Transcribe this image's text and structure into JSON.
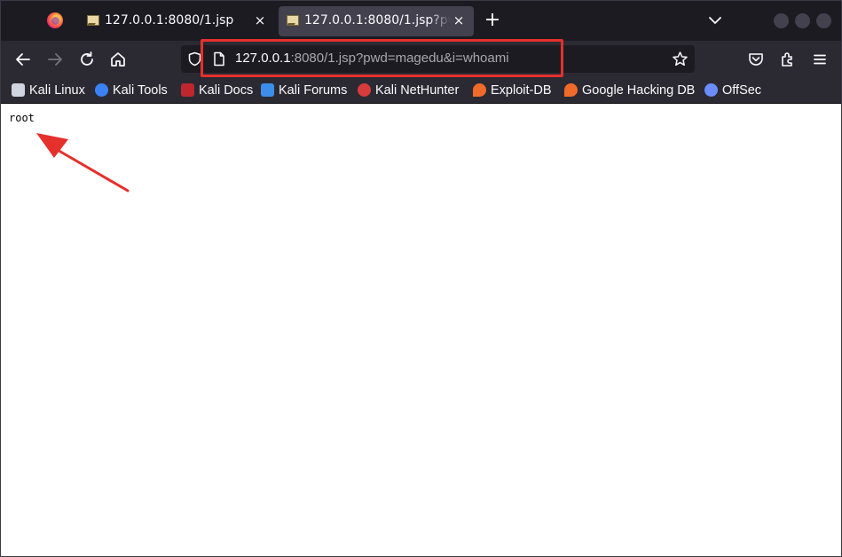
{
  "tabs": [
    {
      "title": "127.0.0.1:8080/1.jsp",
      "close": "×",
      "active": false
    },
    {
      "title": "127.0.0.1:8080/1.jsp?pwd=magedu&i=whoami",
      "close": "×",
      "active": true
    }
  ],
  "toolbar": {
    "new_tab": "+",
    "back_icon": "arrow-left-icon",
    "forward_icon": "arrow-right-icon",
    "reload_icon": "reload-icon",
    "home_icon": "home-icon"
  },
  "urlbar": {
    "host": "127.0.0.1",
    "rest": ":8080/1.jsp?pwd=magedu&i=whoami"
  },
  "bookmarks": [
    {
      "label": "Kali Linux",
      "color": "#cfd4e0"
    },
    {
      "label": "Kali Tools",
      "color": "#3b82f6"
    },
    {
      "label": "Kali Docs",
      "color": "#c0262d"
    },
    {
      "label": "Kali Forums",
      "color": "#3d8ee8"
    },
    {
      "label": "Kali NetHunter",
      "color": "#d73b3b"
    },
    {
      "label": "Exploit-DB",
      "color": "#f06b2a"
    },
    {
      "label": "Google Hacking DB",
      "color": "#f06b2a"
    },
    {
      "label": "OffSec",
      "color": "#6b8cff"
    }
  ],
  "page": {
    "output": "root"
  },
  "colors": {
    "annotation_red": "#e5302c"
  }
}
